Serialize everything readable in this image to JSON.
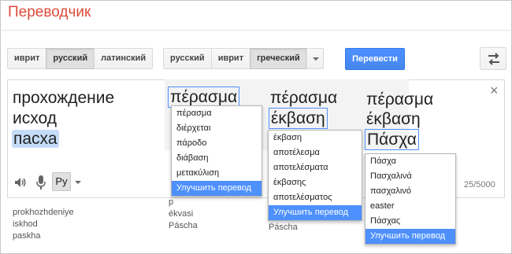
{
  "app": {
    "title": "Переводчик"
  },
  "source_langs": [
    {
      "label": "иврит",
      "active": false
    },
    {
      "label": "русский",
      "active": true
    },
    {
      "label": "латинский",
      "active": false
    }
  ],
  "target_langs": [
    {
      "label": "русский",
      "active": false
    },
    {
      "label": "иврит",
      "active": false
    },
    {
      "label": "греческий",
      "active": true
    }
  ],
  "translate_button": "Перевести",
  "source": {
    "lines": [
      "прохождение",
      "исход",
      "пасха"
    ],
    "ime_label": "Ру",
    "char_count": "25/5000",
    "close": "×"
  },
  "translit_source": [
    "prokhozhdeniye",
    "iskhod",
    "paskha"
  ],
  "columns": [
    {
      "words": [
        "πέρασμα"
      ],
      "dropdown": [
        "πέρασμα",
        "διέρχεται",
        "πάροδο",
        "διάβαση",
        "μετακύλιση"
      ],
      "improve": "Улучшить перевод",
      "translit": [
        "p",
        "ékvasi",
        "Páscha"
      ]
    },
    {
      "words": [
        "πέρασμα",
        "έκβαση"
      ],
      "dropdown": [
        "έκβαση",
        "αποτέλεσμα",
        "αποτελέσματα",
        "έκβασης",
        "αποτελέσματος"
      ],
      "improve": "Улучшить перевод",
      "translit": [
        "Páscha"
      ]
    },
    {
      "words": [
        "πέρασμα",
        "έκβαση",
        "Πάσχα"
      ],
      "dropdown": [
        "Πάσχα",
        "Πασχαλινά",
        "πασχαλινό",
        "easter",
        "Πάσχας"
      ],
      "improve": "Улучшить перевод"
    }
  ],
  "colors": {
    "brand_red": "#dd4b39",
    "accent_blue": "#4d90fe",
    "highlight": "#c5dcf8"
  },
  "icons": [
    "speaker-icon",
    "microphone-icon",
    "swap-languages-icon",
    "chevron-down-icon",
    "close-icon"
  ]
}
